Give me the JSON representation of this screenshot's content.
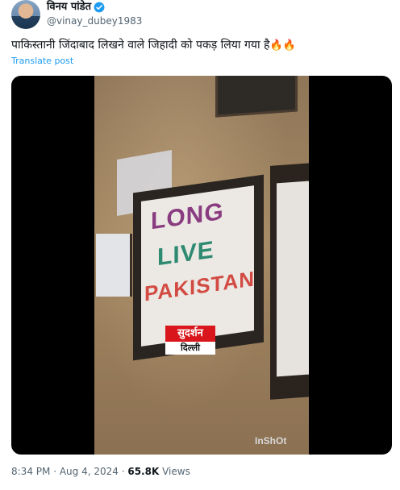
{
  "author": {
    "display_name": "विनय पांडेत",
    "handle": "@vinay_dubey1983",
    "verified_color": "#1d9bf0"
  },
  "tweet": {
    "text": "पाकिस्तानी जिंदाबाद लिखने वाले जिहादी को पकड़ लिया गया है",
    "emoji": "🔥🔥",
    "translate_label": "Translate post"
  },
  "media": {
    "sign_lines": [
      "LONG",
      "LIVE",
      "PAKISTAN"
    ],
    "logo_top": "सुदर्शन",
    "logo_bottom": "दिल्ली",
    "watermark": "InShOt"
  },
  "meta": {
    "time": "8:34 PM",
    "date": "Aug 4, 2024",
    "views_count": "65.8K",
    "views_label": "Views"
  }
}
